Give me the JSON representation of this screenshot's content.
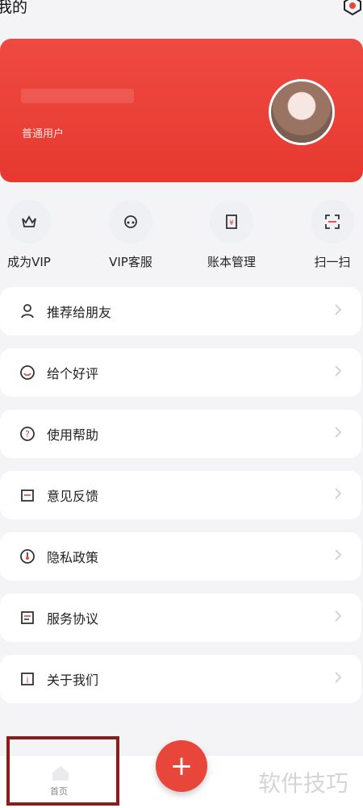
{
  "header": {
    "title": "我的"
  },
  "profile": {
    "user_type": "普通用户"
  },
  "quick_actions": [
    {
      "label": "成为VIP",
      "icon": "crown-icon"
    },
    {
      "label": "VIP客服",
      "icon": "customer-service-icon"
    },
    {
      "label": "账本管理",
      "icon": "ledger-icon"
    },
    {
      "label": "扫一扫",
      "icon": "scan-icon"
    }
  ],
  "menu": [
    {
      "label": "推荐给朋友",
      "icon": "user-icon"
    },
    {
      "label": "给个好评",
      "icon": "smile-icon"
    },
    {
      "label": "使用帮助",
      "icon": "help-icon"
    },
    {
      "label": "意见反馈",
      "icon": "feedback-icon"
    },
    {
      "label": "隐私政策",
      "icon": "privacy-icon"
    },
    {
      "label": "服务协议",
      "icon": "agreement-icon"
    },
    {
      "label": "关于我们",
      "icon": "info-icon"
    }
  ],
  "nav": {
    "home_label": "首页",
    "fab": "+"
  },
  "watermark": "软件技巧",
  "colors": {
    "accent": "#e8453b"
  }
}
